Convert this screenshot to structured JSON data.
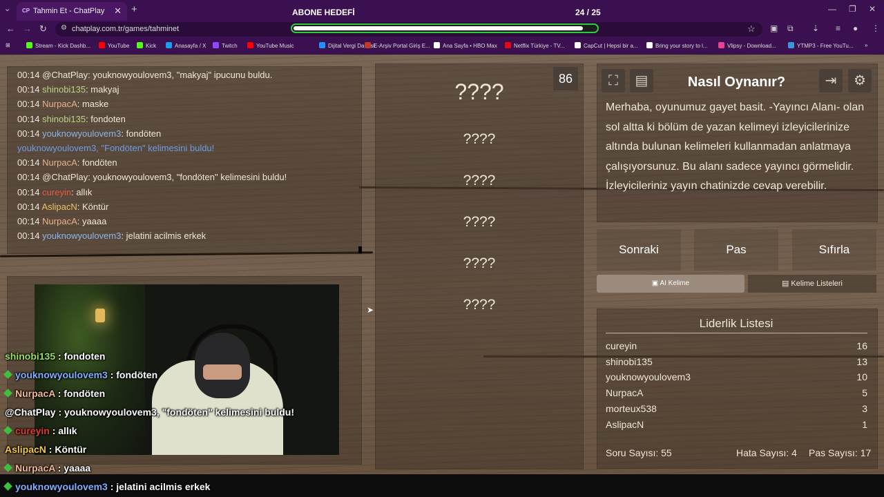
{
  "browser": {
    "tab_title": "Tahmin Et - ChatPlay",
    "tab_favicon": "CP",
    "url": "chatplay.com.tr/games/tahminet",
    "sub_goal_label": "ABONE HEDEFİ",
    "sub_goal_count": "24 / 25",
    "sub_goal_progress": 0.96,
    "bookmarks": [
      {
        "label": "Stream - Kick Dashb...",
        "color": "#53fc18"
      },
      {
        "label": "YouTube",
        "color": "#ff0000"
      },
      {
        "label": "Kick",
        "color": "#53fc18"
      },
      {
        "label": "Anasayfa / X",
        "color": "#1d9bf0"
      },
      {
        "label": "Twitch",
        "color": "#9146ff"
      },
      {
        "label": "YouTube Music",
        "color": "#ff0000"
      },
      {
        "label": "Dijital Vergi Dairesi",
        "color": "#1e90ff"
      },
      {
        "label": "E-Arşiv Portal Giriş E...",
        "color": "#c0392b"
      },
      {
        "label": "Ana Sayfa • HBO Max",
        "color": "#ffffff"
      },
      {
        "label": "Netflix Türkiye - TV...",
        "color": "#e50914"
      },
      {
        "label": "CapCut | Hepsi bir a...",
        "color": "#ffffff"
      },
      {
        "label": "Bring your story to l...",
        "color": "#ffffff"
      },
      {
        "label": "Vlipsy - Download...",
        "color": "#e84393"
      },
      {
        "label": "YTMP3 - Free YouTu...",
        "color": "#3498db"
      }
    ]
  },
  "chat_log": [
    {
      "time": "00:14",
      "user": "@ChatPlay",
      "msg": ": youknowyoulovem3, \"makyaj\" ipucunu buldu.",
      "color": "sys"
    },
    {
      "time": "00:14",
      "user": "shinobi135",
      "msg": ": makyaj",
      "color": "green"
    },
    {
      "time": "00:14",
      "user": "NurpacA",
      "msg": ": maske",
      "color": "peach"
    },
    {
      "time": "00:14",
      "user": "shinobi135",
      "msg": ": fondoten",
      "color": "green"
    },
    {
      "time": "00:14",
      "user": "youknowyoulovem3",
      "msg": ": fondöten",
      "color": "blue"
    },
    {
      "time": "",
      "user": "youknowyoulovem3, \"Fondöten\" kelimesini buldu!",
      "msg": "",
      "color": "sysblue"
    },
    {
      "time": "00:14",
      "user": "NurpacA",
      "msg": ": fondöten",
      "color": "peach"
    },
    {
      "time": "00:14",
      "user": "@ChatPlay",
      "msg": ": youknowyoulovem3, \"fondöten\" kelimesini buldu!",
      "color": "sys"
    },
    {
      "time": "00:14",
      "user": "cureyin",
      "msg": ": allık",
      "color": "red"
    },
    {
      "time": "00:14",
      "user": "AslipacN",
      "msg": ": Köntür",
      "color": "yellow"
    },
    {
      "time": "00:14",
      "user": "NurpacA",
      "msg": ": yaaaa",
      "color": "peach"
    },
    {
      "time": "00:14",
      "user": "youknowyoulovem3",
      "msg": ": jelatini acilmis erkek",
      "color": "blue"
    }
  ],
  "overlay_chat": [
    {
      "user": "shinobi135",
      "msg": " : fondoten",
      "color": "#9be060",
      "gem": false
    },
    {
      "user": "youknowyoulovem3",
      "msg": " : fondöten",
      "color": "#7fb0ff",
      "gem": true
    },
    {
      "user": "NurpacA",
      "msg": " : fondöten",
      "color": "#f0b98f",
      "gem": true
    },
    {
      "user": "@ChatPlay",
      "msg": " : youknowyoulovem3, \"fondöten\" kelimesini buldu!",
      "color": "#ffffff",
      "gem": false
    },
    {
      "user": "cureyin",
      "msg": " : allık",
      "color": "#e03c2a",
      "gem": true
    },
    {
      "user": "AslipacN",
      "msg": " : Köntür",
      "color": "#f2c84b",
      "gem": false
    },
    {
      "user": "NurpacA",
      "msg": " : yaaaa",
      "color": "#f0b98f",
      "gem": true
    },
    {
      "user": "youknowyoulovem3",
      "msg": " : jelatini acilmis erkek",
      "color": "#7fb0ff",
      "gem": true
    }
  ],
  "game": {
    "timer": "86",
    "main_word": "????",
    "taboo_words": [
      "????",
      "????",
      "????",
      "????",
      "????"
    ]
  },
  "howto": {
    "title": "Nasıl Oynanır?",
    "text": "Merhaba, oyunumuz gayet basit. -Yayıncı Alanı- olan sol altta ki bölüm de yazan kelimeyi izleyicilerinize altında bulunan kelimeleri kullanmadan anlatmaya çalışıyorsunuz. Bu alanı sadece yayıncı görmelidir. İzleyicileriniz yayın chatinizde cevap verebilir."
  },
  "buttons": {
    "next": "Sonraki",
    "pass": "Pas",
    "reset": "Sıfırla",
    "ai_word": "AI Kelime",
    "word_lists": "Kelime Listeleri"
  },
  "leaderboard": {
    "title": "Liderlik Listesi",
    "rows": [
      {
        "name": "cureyin",
        "score": "16"
      },
      {
        "name": "shinobi135",
        "score": "13"
      },
      {
        "name": "youknowyoulovem3",
        "score": "10"
      },
      {
        "name": "NurpacA",
        "score": "5"
      },
      {
        "name": "morteux538",
        "score": "3"
      },
      {
        "name": "AslipacN",
        "score": "1"
      }
    ]
  },
  "stats": {
    "questions": "Soru Sayısı: 55",
    "errors": "Hata Sayısı: 4",
    "passes": "Pas Sayısı: 17"
  }
}
